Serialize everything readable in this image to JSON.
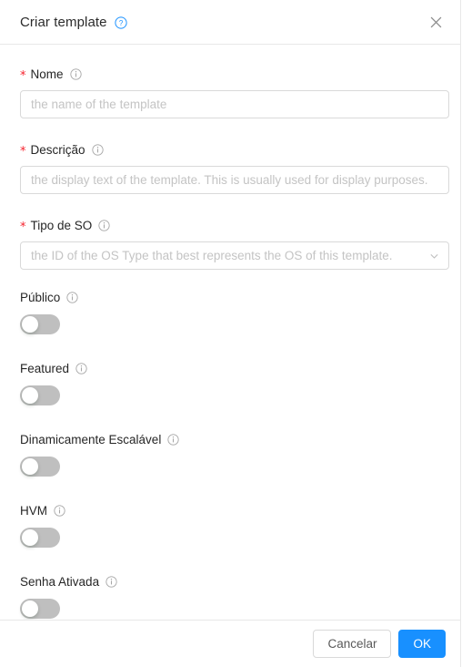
{
  "modal": {
    "title": "Criar template",
    "help_icon": "question-circle-icon",
    "close_icon": "close-icon",
    "accent_color": "#1890ff",
    "required_star": "*"
  },
  "form": {
    "fields": [
      {
        "key": "name",
        "label": "Nome",
        "required": true,
        "type": "text",
        "value": "",
        "placeholder": "the name of the template",
        "info_icon": "info-circle-icon"
      },
      {
        "key": "description",
        "label": "Descrição",
        "required": true,
        "type": "text",
        "value": "",
        "placeholder": "the display text of the template. This is usually used for display purposes.",
        "info_icon": "info-circle-icon"
      },
      {
        "key": "ostypeid",
        "label": "Tipo de SO",
        "required": true,
        "type": "select",
        "value": "",
        "placeholder": "the ID of the OS Type that best represents the OS of this template.",
        "arrow_icon": "chevron-down-icon",
        "info_icon": "info-circle-icon"
      }
    ],
    "switches": [
      {
        "key": "ispublic",
        "label": "Público",
        "checked": false,
        "info_icon": "info-circle-icon"
      },
      {
        "key": "isfeatured",
        "label": "Featured",
        "checked": false,
        "info_icon": "info-circle-icon"
      },
      {
        "key": "isdynamicallyscalable",
        "label": "Dinamicamente Escalável",
        "checked": false,
        "info_icon": "info-circle-icon"
      },
      {
        "key": "requireshvm",
        "label": "HVM",
        "checked": false,
        "info_icon": "info-circle-icon"
      },
      {
        "key": "passwordenabled",
        "label": "Senha Ativada",
        "checked": false,
        "info_icon": "info-circle-icon"
      }
    ]
  },
  "footer": {
    "cancel_label": "Cancelar",
    "ok_label": "OK"
  }
}
